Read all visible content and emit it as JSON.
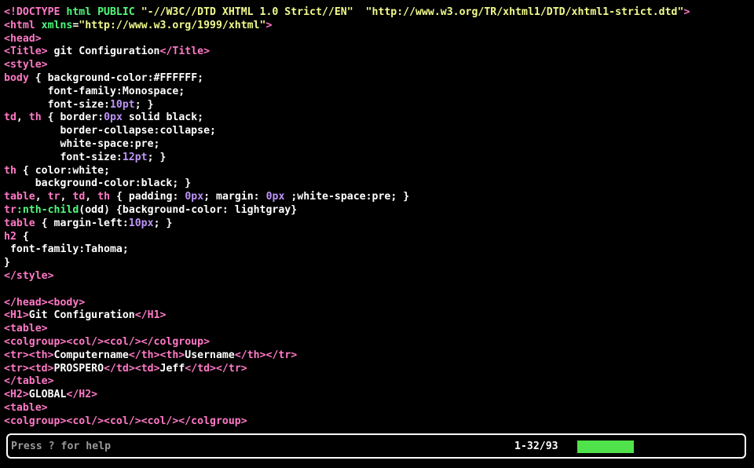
{
  "colors": {
    "tag": "#ff79c6",
    "attr": "#50fa7b",
    "string": "#f1fa8c",
    "number": "#bd93f9",
    "text": "#ffffff",
    "progress": "#50e24a"
  },
  "code_lines": [
    [
      [
        "tag",
        "<!DOCTYPE "
      ],
      [
        "attr",
        "html PUBLIC "
      ],
      [
        "str",
        "\"-//W3C//DTD XHTML 1.0 Strict//EN\"  \"http://www.w3.org/TR/xhtml1/DTD/xhtml1-strict.dtd\""
      ],
      [
        "tag",
        ">"
      ]
    ],
    [
      [
        "tag",
        "<html "
      ],
      [
        "attr",
        "xmlns"
      ],
      [
        "text",
        "="
      ],
      [
        "str",
        "\"http://www.w3.org/1999/xhtml\""
      ],
      [
        "tag",
        ">"
      ]
    ],
    [
      [
        "tag",
        "<head>"
      ]
    ],
    [
      [
        "tag",
        "<Title>"
      ],
      [
        "text",
        " git Configuration"
      ],
      [
        "tag",
        "</Title>"
      ]
    ],
    [
      [
        "tag",
        "<style>"
      ]
    ],
    [
      [
        "tag",
        "body"
      ],
      [
        "text",
        " { background-color:#FFFFFF;"
      ]
    ],
    [
      [
        "text",
        "       font-family:Monospace;"
      ]
    ],
    [
      [
        "text",
        "       font-size:"
      ],
      [
        "num",
        "10pt"
      ],
      [
        "text",
        "; }"
      ]
    ],
    [
      [
        "tag",
        "td"
      ],
      [
        "text",
        ", "
      ],
      [
        "tag",
        "th"
      ],
      [
        "text",
        " { border:"
      ],
      [
        "num",
        "0px"
      ],
      [
        "text",
        " solid black;"
      ]
    ],
    [
      [
        "text",
        "         border-collapse:collapse;"
      ]
    ],
    [
      [
        "text",
        "         white-space:pre;"
      ]
    ],
    [
      [
        "text",
        "         font-size:"
      ],
      [
        "num",
        "12pt"
      ],
      [
        "text",
        "; }"
      ]
    ],
    [
      [
        "tag",
        "th"
      ],
      [
        "text",
        " { color:white;"
      ]
    ],
    [
      [
        "text",
        "     background-color:black; }"
      ]
    ],
    [
      [
        "tag",
        "table"
      ],
      [
        "text",
        ", "
      ],
      [
        "tag",
        "tr"
      ],
      [
        "text",
        ", "
      ],
      [
        "tag",
        "td"
      ],
      [
        "text",
        ", "
      ],
      [
        "tag",
        "th"
      ],
      [
        "text",
        " { padding: "
      ],
      [
        "num",
        "0px"
      ],
      [
        "text",
        "; margin: "
      ],
      [
        "num",
        "0px"
      ],
      [
        "text",
        " ;white-space:pre; }"
      ]
    ],
    [
      [
        "tag",
        "tr"
      ],
      [
        "attr",
        ":nth-child"
      ],
      [
        "text",
        "(odd) {background-color: lightgray}"
      ]
    ],
    [
      [
        "tag",
        "table"
      ],
      [
        "text",
        " { margin-left:"
      ],
      [
        "num",
        "10px"
      ],
      [
        "text",
        "; }"
      ]
    ],
    [
      [
        "tag",
        "h2"
      ],
      [
        "text",
        " {"
      ]
    ],
    [
      [
        "text",
        " font-family:Tahoma;"
      ]
    ],
    [
      [
        "text",
        "}"
      ]
    ],
    [
      [
        "tag",
        "</style>"
      ]
    ],
    [],
    [
      [
        "tag",
        "</head><body>"
      ]
    ],
    [
      [
        "tag",
        "<H1>"
      ],
      [
        "text",
        "Git Configuration"
      ],
      [
        "tag",
        "</H1>"
      ]
    ],
    [
      [
        "tag",
        "<table>"
      ]
    ],
    [
      [
        "tag",
        "<colgroup><col/><col/></colgroup>"
      ]
    ],
    [
      [
        "tag",
        "<tr><th>"
      ],
      [
        "text",
        "Computername"
      ],
      [
        "tag",
        "</th><th>"
      ],
      [
        "text",
        "Username"
      ],
      [
        "tag",
        "</th></tr>"
      ]
    ],
    [
      [
        "tag",
        "<tr><td>"
      ],
      [
        "text",
        "PROSPERO"
      ],
      [
        "tag",
        "</td><td>"
      ],
      [
        "text",
        "Jeff"
      ],
      [
        "tag",
        "</td></tr>"
      ]
    ],
    [
      [
        "tag",
        "</table>"
      ]
    ],
    [
      [
        "tag",
        "<H2>"
      ],
      [
        "text",
        "GLOBAL"
      ],
      [
        "tag",
        "</H2>"
      ]
    ],
    [
      [
        "tag",
        "<table>"
      ]
    ],
    [
      [
        "tag",
        "<colgroup><col/><col/><col/></colgroup>"
      ]
    ]
  ],
  "statusbar": {
    "help_text": "Press ? for help",
    "position": "1-32/93",
    "progress_fraction": 0.344
  }
}
